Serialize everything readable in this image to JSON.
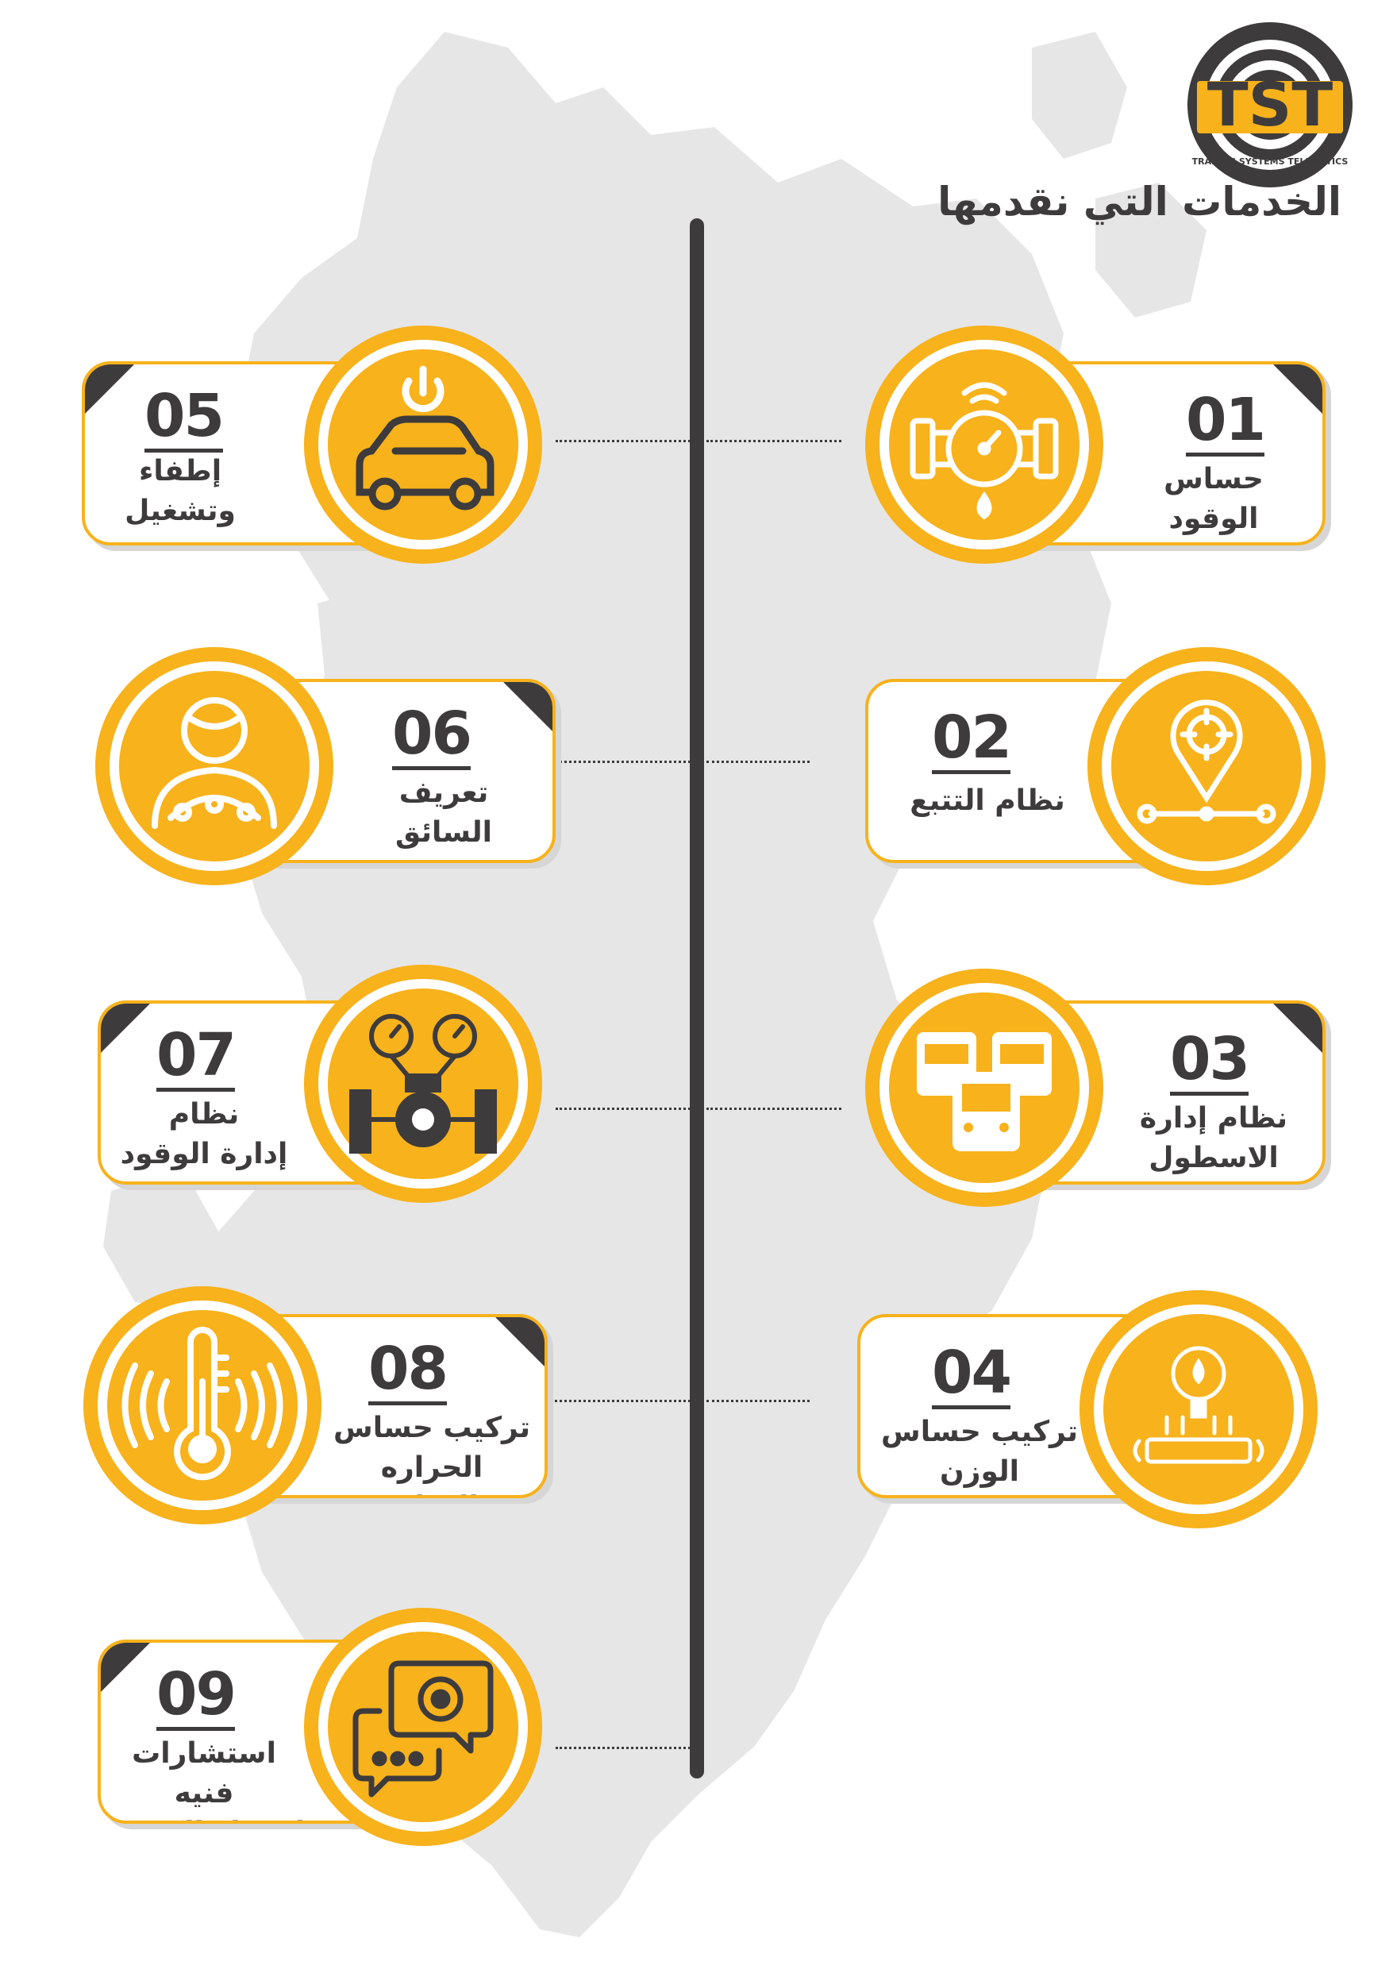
{
  "logo": {
    "text": "TST",
    "tagline": "TRAKING SYSTEMS TELEMATICS"
  },
  "title": "الخدمات التي نقدمها",
  "colors": {
    "accent": "#f7b21c",
    "dark": "#3d3b3c",
    "map": "#e6e6e7"
  },
  "services": [
    {
      "num": "01",
      "label_line1": "حساس",
      "label_line2": "الوقود",
      "icon": "fuel-sensor-icon"
    },
    {
      "num": "02",
      "label_line1": "نظام التتبع",
      "label_line2": "",
      "icon": "location-tracking-icon"
    },
    {
      "num": "03",
      "label_line1": "نظام إدارة",
      "label_line2": "الاسطول",
      "icon": "fleet-trucks-icon"
    },
    {
      "num": "04",
      "label_line1": "تركيب حساس",
      "label_line2": "الوزن",
      "icon": "weight-sensor-icon"
    },
    {
      "num": "05",
      "label_line1": "إطفاء",
      "label_line2": "وتشغيل",
      "icon": "car-power-icon"
    },
    {
      "num": "06",
      "label_line1": "تعريف",
      "label_line2": "السائق",
      "icon": "driver-icon"
    },
    {
      "num": "07",
      "label_line1": "نظام",
      "label_line2": "إدارة الوقود",
      "icon": "fuel-management-icon"
    },
    {
      "num": "08",
      "label_line1": "تركيب حساس",
      "label_line2": "الحراره والرطوبه",
      "icon": "thermometer-icon"
    },
    {
      "num": "09",
      "label_line1": "استشارات فنيه",
      "label_line2": "لاصدار الكروت",
      "icon": "consulting-chat-icon"
    }
  ]
}
